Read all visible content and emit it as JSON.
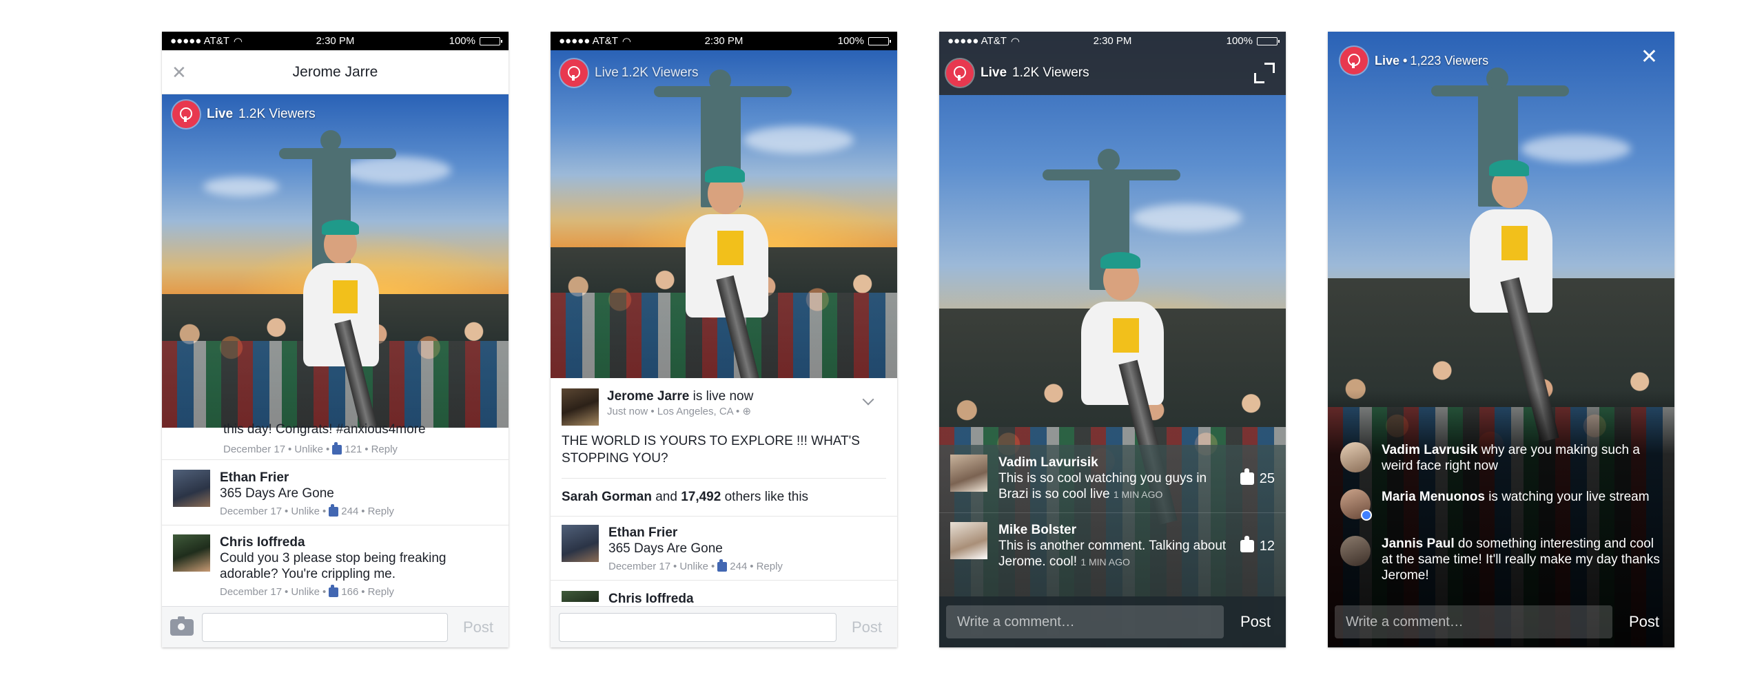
{
  "status": {
    "carrier": "●●●●● AT&T",
    "wifi": "wifi-icon",
    "time": "2:30 PM",
    "battery": "100%"
  },
  "phone1": {
    "title": "Jerome Jarre",
    "live": {
      "label": "Live",
      "viewers": "1.2K Viewers"
    },
    "comments": [
      {
        "name": "",
        "text": "this day! Congrats! #anxious4more",
        "date": "December 17",
        "unlike": "Unlike",
        "count": "121",
        "reply": "Reply"
      },
      {
        "name": "Ethan Frier",
        "text": "365 Days Are Gone",
        "date": "December 17",
        "unlike": "Unlike",
        "count": "244",
        "reply": "Reply"
      },
      {
        "name": "Chris Ioffreda",
        "text": "Could you 3 please stop being freaking adorable? You're crippling me.",
        "date": "December 17",
        "unlike": "Unlike",
        "count": "166",
        "reply": "Reply"
      }
    ],
    "composer": {
      "placeholder": "",
      "post": "Post"
    }
  },
  "phone2": {
    "live": {
      "label": "Live",
      "viewers": "1.2K Viewers"
    },
    "post": {
      "author": "Jerome Jarre",
      "action": "is live now",
      "meta": "Just now • Los Angeles, CA •",
      "text": "THE WORLD IS YOURS TO EXPLORE !!! WHAT'S STOPPING YOU?",
      "likes_name": "Sarah Gorman",
      "likes_and": "and",
      "likes_count": "17,492",
      "likes_rest": "others like this"
    },
    "comments": [
      {
        "name": "Ethan Frier",
        "text": "365 Days Are Gone",
        "date": "December 17",
        "unlike": "Unlike",
        "count": "244",
        "reply": "Reply"
      },
      {
        "name": "Chris Ioffreda"
      }
    ],
    "composer": {
      "placeholder": "",
      "post": "Post"
    }
  },
  "phone3": {
    "live": {
      "label": "Live",
      "viewers": "1.2K Viewers"
    },
    "comments": [
      {
        "name": "Vadim Lavurisik",
        "text": "This is so cool watching you guys in Brazi is so cool live",
        "time": "1 MIN AGO",
        "likes": "25"
      },
      {
        "name": "Mike Bolster",
        "text": "This is another comment. Talking about Jerome. cool!",
        "time": "1 MIN AGO",
        "likes": "12"
      }
    ],
    "composer": {
      "placeholder": "Write a comment…",
      "post": "Post"
    }
  },
  "phone4": {
    "live": {
      "label": "Live •",
      "viewers": "1,223 Viewers"
    },
    "comments": [
      {
        "name": "Vadim Lavrusik",
        "text": "why are you making such a weird face right now"
      },
      {
        "name": "Maria Menuonos",
        "text": "is watching your live stream"
      },
      {
        "name": "Jannis Paul",
        "text": "do something interesting and cool at the same time! It'll really make my day thanks Jerome!"
      }
    ],
    "composer": {
      "placeholder": "Write a comment…",
      "post": "Post"
    }
  }
}
